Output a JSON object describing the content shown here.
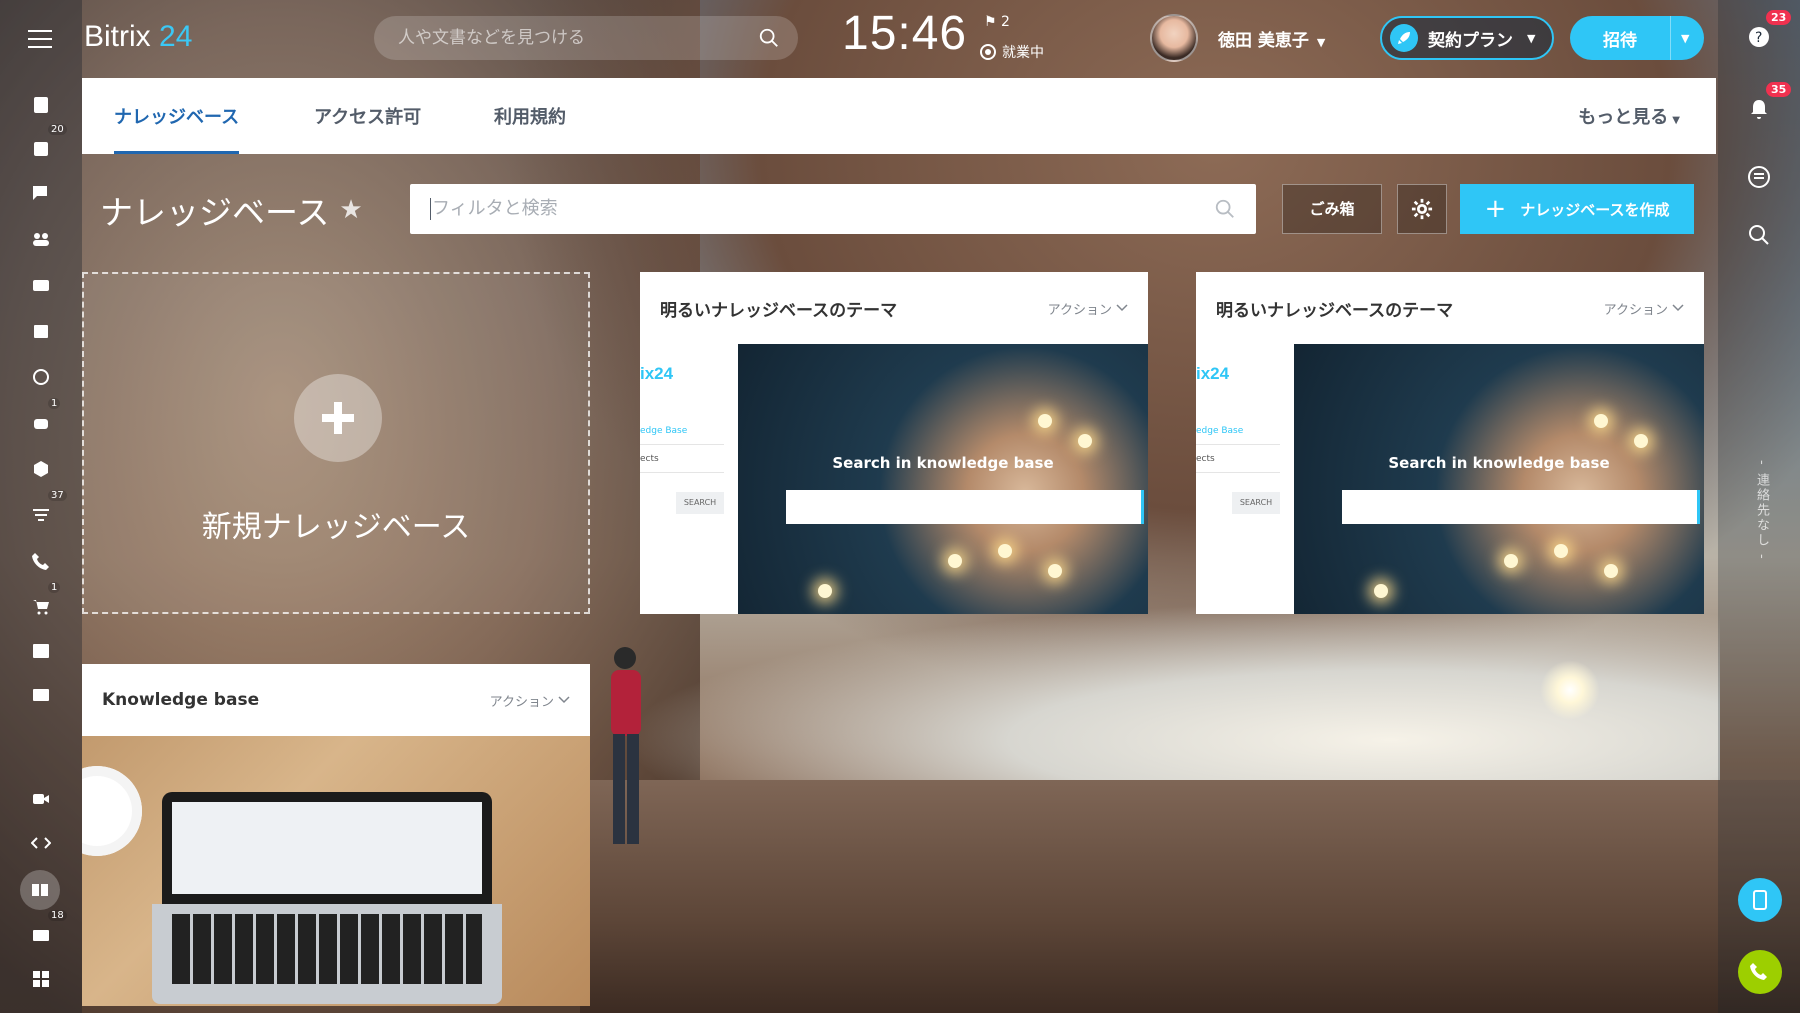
{
  "header": {
    "logo_text": "Bitrix",
    "logo_num": "24",
    "search_placeholder": "人や文書などを見つける",
    "clock": "15:46",
    "flag_count": "2",
    "work_status": "就業中",
    "user_name": "徳田 美恵子",
    "plan_label": "契約プラン",
    "invite_label": "招待"
  },
  "sidebar": {
    "badges": {
      "tasks": "20",
      "robot": "1",
      "filter": "37",
      "cart": "1",
      "mail": "18"
    }
  },
  "right_panel": {
    "help_badge": "23",
    "notification_badge": "35",
    "vertical_text": "- 連絡先なし -"
  },
  "tabs": {
    "items": [
      "ナレッジベース",
      "アクセス許可",
      "利用規約"
    ],
    "more": "もっと見る"
  },
  "page": {
    "title": "ナレッジベース",
    "filter_placeholder": "フィルタと検索",
    "trash_label": "ごみ箱",
    "create_label": "ナレッジベースを作成"
  },
  "cards": {
    "new_label": "新規ナレッジベース",
    "action_label": "アクション",
    "items": [
      {
        "title": "明るいナレッジベースのテーマ",
        "brand": "ix24",
        "link": "edge Base",
        "projects": "ects",
        "search_btn": "SEARCH",
        "caption": "Search in knowledge base"
      },
      {
        "title": "明るいナレッジベースのテーマ",
        "brand": "ix24",
        "link": "edge Base",
        "projects": "ects",
        "search_btn": "SEARCH",
        "caption": "Search in knowledge base"
      },
      {
        "title": "Knowledge base"
      }
    ]
  },
  "colors": {
    "accent": "#2fc6f6",
    "tab_active": "#2067b0",
    "badge_red": "#f0314f"
  }
}
